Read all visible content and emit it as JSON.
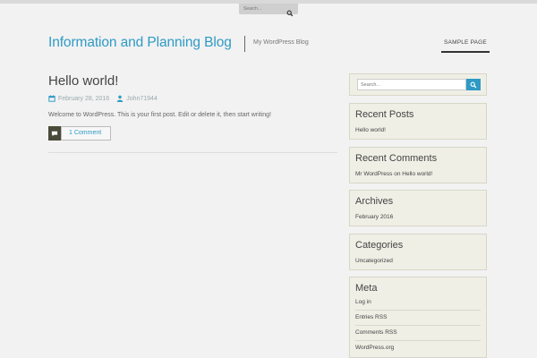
{
  "top_search": {
    "placeholder": "Search..."
  },
  "header": {
    "site_title": "Information and Planning Blog",
    "tagline": "My WordPress Blog",
    "nav": [
      "SAMPLE PAGE"
    ]
  },
  "post": {
    "title": "Hello world!",
    "date": "February 28, 2016",
    "author": "John71944",
    "excerpt": "Welcome to WordPress. This is your first post. Edit or delete it, then start writing!",
    "comments_link": "1 Comment"
  },
  "sidebar": {
    "search_placeholder": "Search...",
    "recent_posts": {
      "title": "Recent Posts",
      "items": [
        "Hello world!"
      ]
    },
    "recent_comments": {
      "title": "Recent Comments",
      "items": [
        "Mr WordPress on Hello world!"
      ]
    },
    "archives": {
      "title": "Archives",
      "items": [
        "February 2016"
      ]
    },
    "categories": {
      "title": "Categories",
      "items": [
        "Uncategorized"
      ]
    },
    "meta": {
      "title": "Meta",
      "items": [
        "Log in",
        "Entries RSS",
        "Comments RSS",
        "WordPress.org"
      ]
    }
  },
  "colors": {
    "accent": "#2e9ac5",
    "background": "#f2f2f2",
    "widget_bg": "#efefe6"
  },
  "icons": [
    "search-icon",
    "calendar-icon",
    "user-icon",
    "comment-icon"
  ]
}
